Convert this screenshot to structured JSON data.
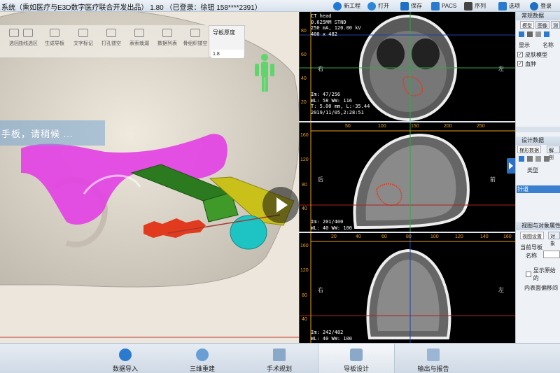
{
  "titlebar": {
    "app_title": "系统（熏如医疗与E3D数字医疗联合开发出品） 1.80 （已登录：徐钮 158****2391）",
    "actions": [
      {
        "label": "新工程",
        "icon": "plus-circle-icon",
        "color": "#1f7ad6"
      },
      {
        "label": "打开",
        "icon": "globe-icon",
        "color": "#2a86d8"
      },
      {
        "label": "保存",
        "icon": "floppy-disk-icon",
        "color": "#1f6fc4"
      },
      {
        "label": "PACS",
        "icon": "monitor-icon",
        "color": "#2a7bd0"
      },
      {
        "label": "序列",
        "icon": "cube-icon",
        "color": "#444444"
      },
      {
        "label": "选项",
        "icon": "options-icon",
        "color": "#2a7bd0"
      },
      {
        "label": "登录",
        "icon": "user-login-icon",
        "color": "#1f6fc4"
      }
    ]
  },
  "toolbar3d": {
    "tools": [
      "选区",
      "曲线选区",
      "生成导板",
      "文字标记",
      "打孔镂空",
      "表索栽漏",
      "数据列表",
      "骨组织镂空"
    ],
    "thickness_label": "导板厚度",
    "thickness_value": "1.8"
  },
  "viewport3d": {
    "wait_message": "手板，请稍候 ...",
    "ruler_ticks": [
      "100",
      "150",
      "200"
    ]
  },
  "ct_axial": {
    "info_top": [
      "CT head",
      "0.625MM STND",
      "250 mA, 120.00 kV",
      "400 x 482"
    ],
    "info_bottom": [
      "Im: 47/256",
      "WL: 58  WW: 116",
      "T: 5.00 mm, L:-35.44",
      "2019/11/05,2:28:51"
    ],
    "y_ticks": [
      "80",
      "60",
      "40",
      "20"
    ],
    "side_left": "右",
    "side_right": "左"
  },
  "ct_sagittal": {
    "info_bottom": [
      "Im: 201/400",
      "WL: 40  WW: 100"
    ],
    "x_ticks": [
      "50",
      "100",
      "150",
      "200",
      "250"
    ],
    "y_ticks": [
      "160",
      "120",
      "80",
      "40"
    ],
    "side_left": "后",
    "side_right": "前"
  },
  "ct_coronal": {
    "info_bottom": [
      "Im: 242/482",
      "WL: 40  WW: 100"
    ],
    "x_ticks": [
      "20",
      "40",
      "60",
      "80",
      "100",
      "120",
      "140",
      "160"
    ],
    "y_ticks": [
      "160",
      "120",
      "80",
      "40"
    ],
    "side_left": "右",
    "side_right": "左"
  },
  "sidebar": {
    "section1_title": "常规数据",
    "tabs1": [
      "模型",
      "图像",
      "测"
    ],
    "col_show": "显示",
    "col_name": "名称",
    "models": [
      {
        "label": "皮肤模型",
        "checked": "✓"
      },
      {
        "label": "血肿",
        "checked": "✓"
      }
    ],
    "section2_title": "设计数据",
    "tabs2": [
      "梯形数据",
      "解剖"
    ],
    "col_type": "类型",
    "selected_item": "针道",
    "section3_title": "视图与对象属性",
    "tabs3": [
      "视图设置",
      "对象"
    ],
    "current_guide": "当前导板",
    "name_label": "名称",
    "show_original": "显示原始的",
    "inner_offset": "内表面偏移间"
  },
  "bottomnav": {
    "items": [
      {
        "label": "数据导入",
        "active": false
      },
      {
        "label": "三维重建",
        "active": false
      },
      {
        "label": "手术规划",
        "active": false
      },
      {
        "label": "导板设计",
        "active": true
      },
      {
        "label": "输出与报告",
        "active": false
      }
    ]
  }
}
